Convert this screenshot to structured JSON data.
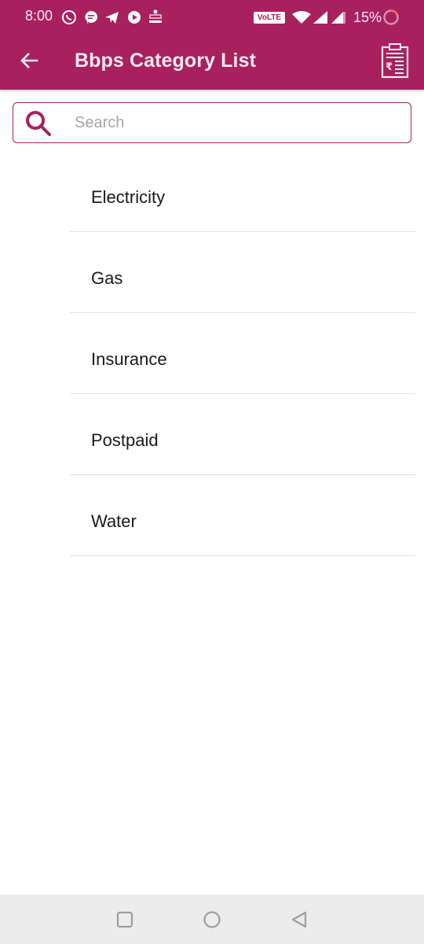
{
  "status_bar": {
    "time": "8:00",
    "notification_icons": [
      "whatsapp-icon",
      "messaging-icon",
      "telegram-icon",
      "youtube-icon",
      "app-notification-icon"
    ],
    "volte_label": "VoLTE",
    "battery": "15%"
  },
  "app_bar": {
    "title": "Bbps Category List",
    "back_icon": "arrow-left-icon",
    "action_icon": "rupee-clipboard-icon"
  },
  "search": {
    "placeholder": "Search",
    "value": ""
  },
  "categories": [
    {
      "label": "Electricity"
    },
    {
      "label": "Gas"
    },
    {
      "label": "Insurance"
    },
    {
      "label": "Postpaid"
    },
    {
      "label": "Water"
    }
  ],
  "nav_bar": {
    "buttons": [
      "recents",
      "home",
      "back"
    ]
  },
  "colors": {
    "primary": "#a8215e",
    "divider": "#e3e3e3",
    "nav_bg": "#ececec"
  }
}
